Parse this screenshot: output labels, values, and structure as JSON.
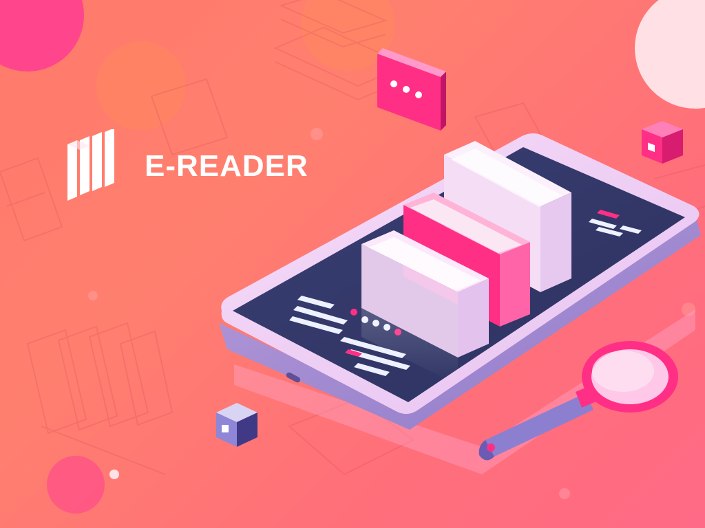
{
  "brand": {
    "title": "E-READER",
    "icon": "books-icon"
  },
  "colors": {
    "background_start": "#ff7a6b",
    "background_end": "#ff6a86",
    "phone_body": "#f2c6ef",
    "phone_screen": "#343a6b",
    "accent_magenta": "#ff2f86",
    "book_light": "#f4dff5",
    "book_white": "#fbeffb"
  },
  "icons": [
    "chat-bubble-icon",
    "magnifying-glass-icon",
    "cube-icon",
    "smartphone-icon",
    "books-icon"
  ]
}
